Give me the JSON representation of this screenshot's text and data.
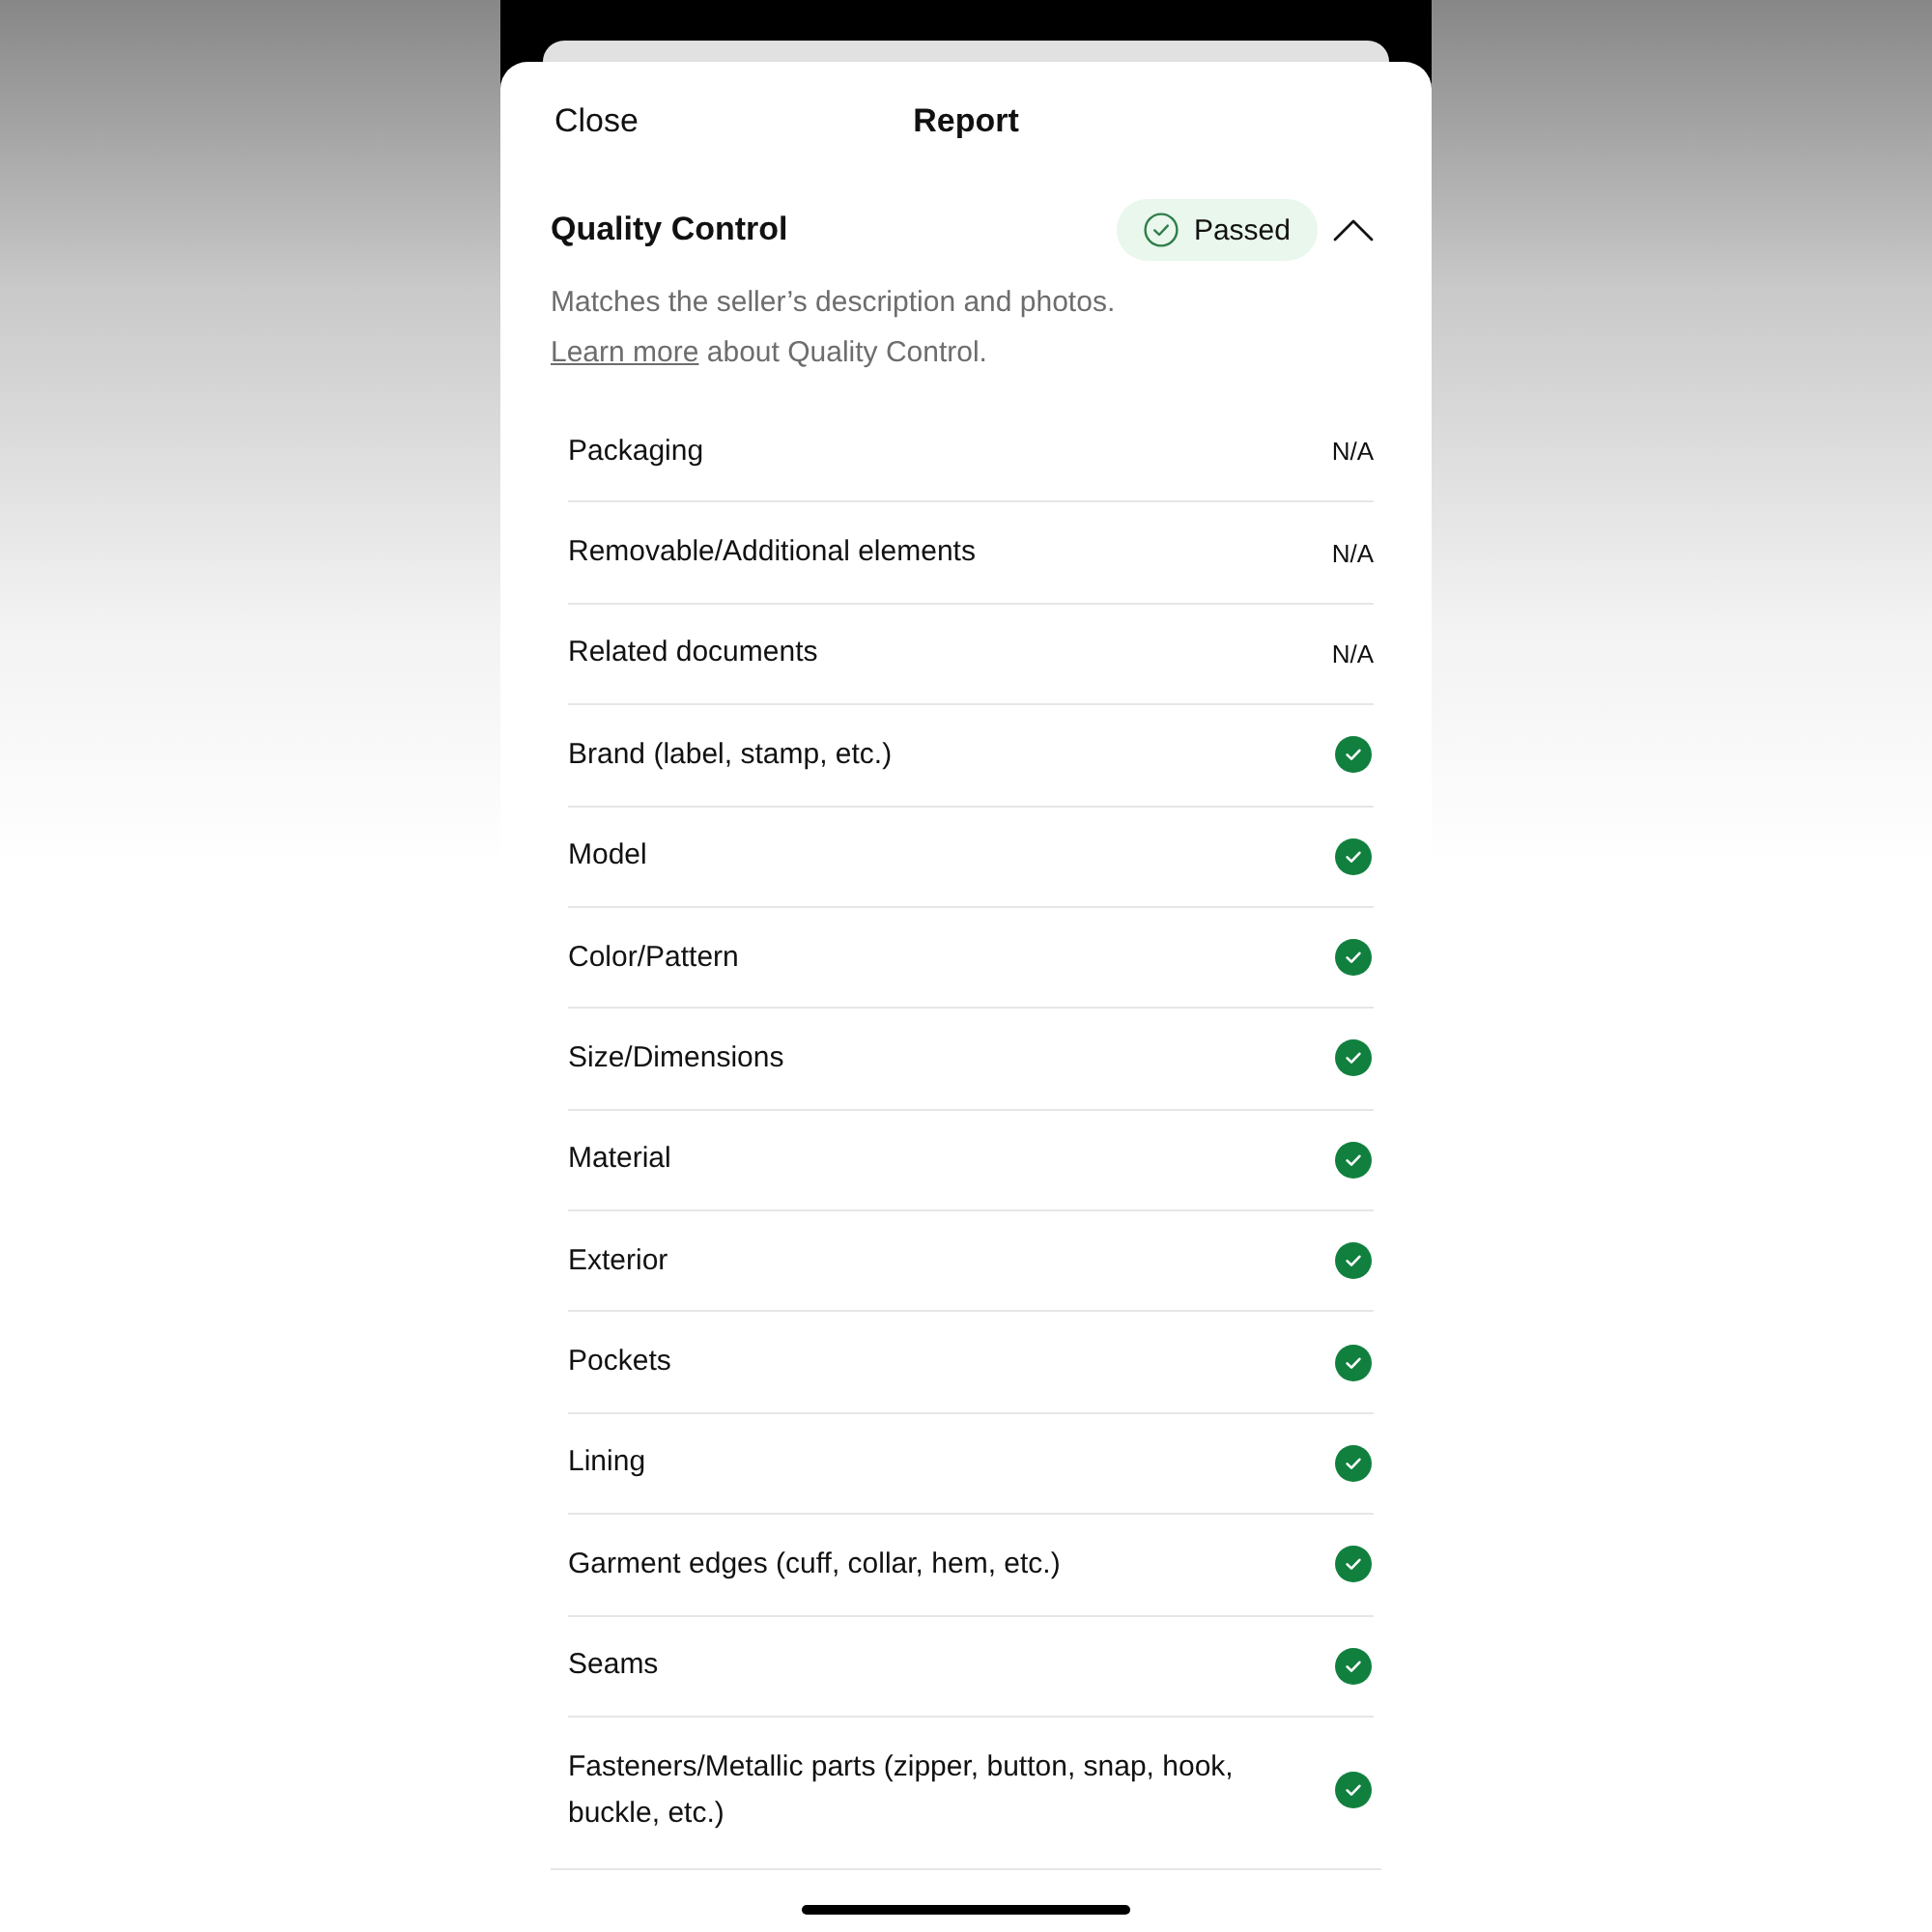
{
  "window": {
    "close": "Close",
    "title": "Report"
  },
  "section": {
    "title": "Quality Control",
    "badge": "Passed",
    "expanded": true,
    "description": "Matches the seller’s description and photos.",
    "link": "Learn more",
    "link_note": "about Quality Control.",
    "items": [
      {
        "label": "Packaging",
        "kind": "value",
        "value": "N/A"
      },
      {
        "label": "Removable/Additional elements",
        "kind": "value",
        "value": "N/A"
      },
      {
        "label": "Related documents",
        "kind": "value",
        "value": "N/A"
      },
      {
        "label": "Brand (label, stamp, etc.)",
        "kind": "check"
      },
      {
        "label": "Model",
        "kind": "check"
      },
      {
        "label": "Color/Pattern",
        "kind": "check"
      },
      {
        "label": "Size/Dimensions",
        "kind": "check"
      },
      {
        "label": "Material",
        "kind": "check"
      },
      {
        "label": "Exterior",
        "kind": "check"
      },
      {
        "label": "Pockets",
        "kind": "check"
      },
      {
        "label": "Lining",
        "kind": "check"
      },
      {
        "label": "Garment edges (cuff, collar, hem, etc.)",
        "kind": "check"
      },
      {
        "label": "Seams",
        "kind": "check"
      },
      {
        "label": "Fasteners/Metallic parts (zipper, button, snap, hook, buckle, etc.)",
        "kind": "check"
      }
    ]
  }
}
